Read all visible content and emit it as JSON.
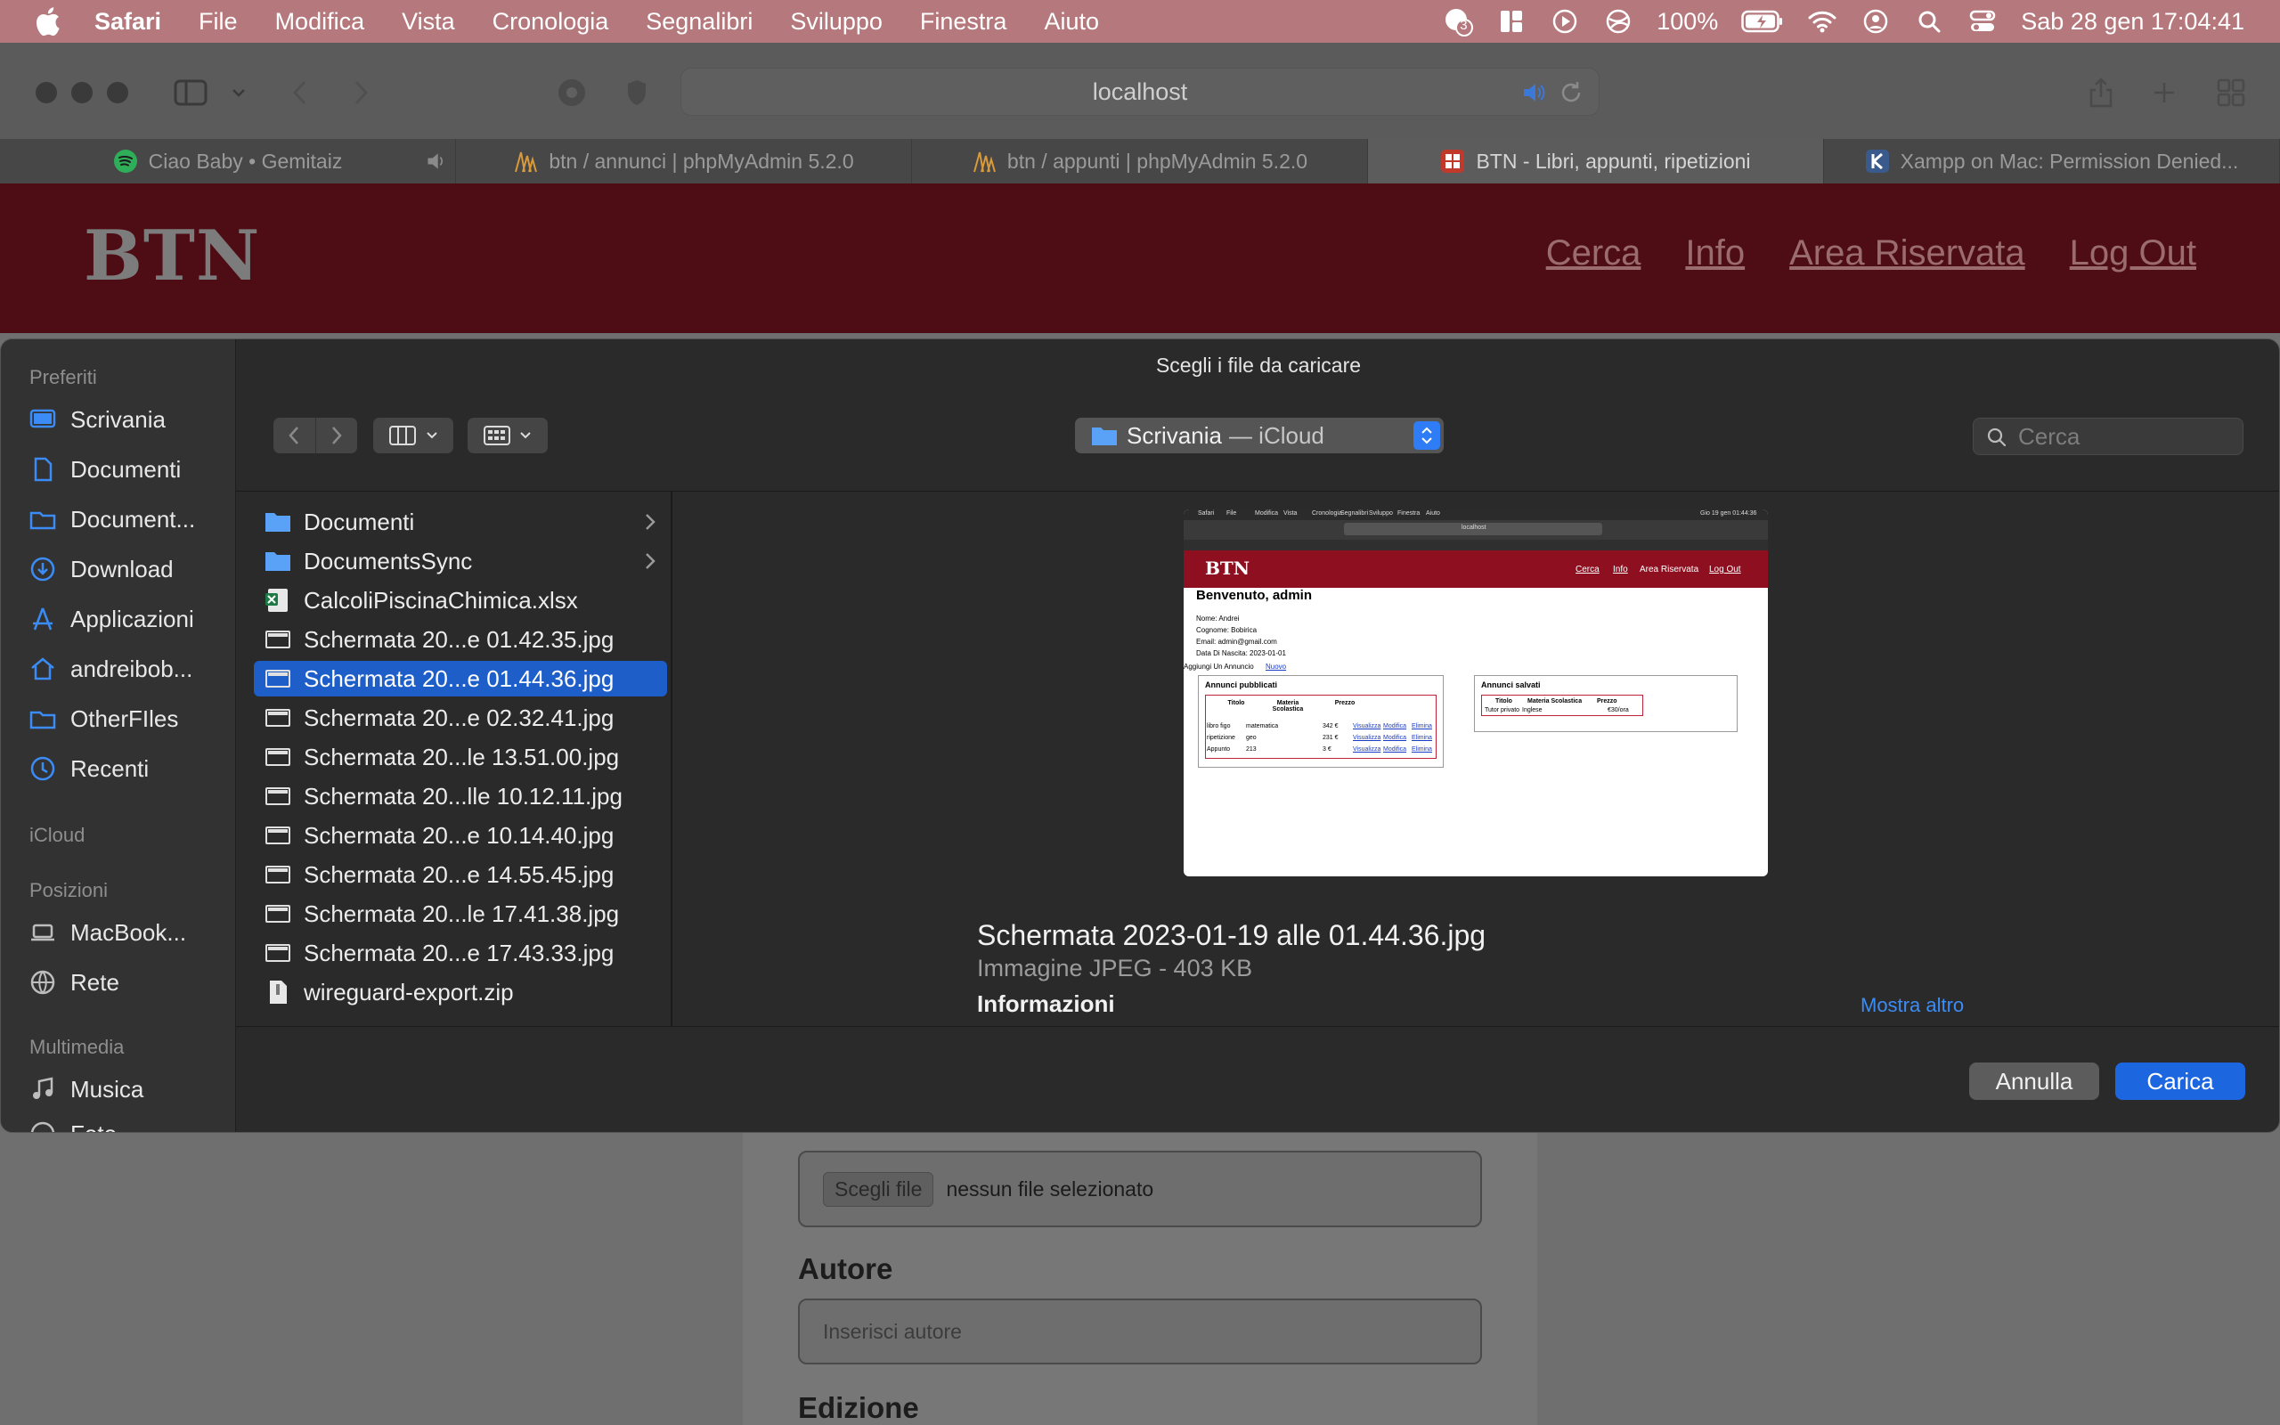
{
  "menubar": {
    "app_name": "Safari",
    "menus": [
      "File",
      "Modifica",
      "Vista",
      "Cronologia",
      "Segnalibri",
      "Sviluppo",
      "Finestra",
      "Aiuto"
    ],
    "badge_count": "3",
    "battery": "100%",
    "datetime": "Sab 28 gen  17:04:41"
  },
  "browser": {
    "address": "localhost",
    "tabs": [
      {
        "title": "Ciao Baby • Gemitaiz",
        "favicon": "spotify-icon"
      },
      {
        "title": "btn / annunci | phpMyAdmin 5.2.0",
        "favicon": "phpmyadmin-icon"
      },
      {
        "title": "btn / appunti | phpMyAdmin 5.2.0",
        "favicon": "phpmyadmin-icon"
      },
      {
        "title": "BTN - Libri, appunti, ripetizioni",
        "favicon": "btn-site-icon"
      },
      {
        "title": "Xampp on Mac: Permission Denied...",
        "favicon": "k-site-icon"
      }
    ]
  },
  "site": {
    "logo": "BTN",
    "nav": [
      "Cerca",
      "Info",
      "Area Riservata",
      "Log Out"
    ],
    "file_button": "Scegli file",
    "file_status": "nessun file selezionato",
    "author_label": "Autore",
    "author_placeholder": "Inserisci autore",
    "edition_label": "Edizione"
  },
  "dialog": {
    "title": "Scegli i file da caricare",
    "location": "Scrivania",
    "location_sub": "— iCloud",
    "search_placeholder": "Cerca",
    "sidebar": {
      "favorites_header": "Preferiti",
      "favorites": [
        {
          "label": "Scrivania",
          "icon": "desktop-icon",
          "active": true
        },
        {
          "label": "Documenti",
          "icon": "document-icon"
        },
        {
          "label": "Document...",
          "icon": "folder-icon"
        },
        {
          "label": "Download",
          "icon": "download-icon"
        },
        {
          "label": "Applicazioni",
          "icon": "applications-icon"
        },
        {
          "label": "andreibob...",
          "icon": "home-icon"
        },
        {
          "label": "OtherFIles",
          "icon": "folder-icon"
        },
        {
          "label": "Recenti",
          "icon": "clock-icon"
        }
      ],
      "icloud_header": "iCloud",
      "locations_header": "Posizioni",
      "locations": [
        {
          "label": "MacBook...",
          "icon": "laptop-icon"
        },
        {
          "label": "Rete",
          "icon": "network-icon"
        }
      ],
      "media_header": "Multimedia",
      "media": [
        {
          "label": "Musica",
          "icon": "music-icon"
        },
        {
          "label": "Foto",
          "icon": "photos-icon"
        }
      ]
    },
    "files": [
      {
        "name": "Documenti",
        "icon": "folder-icon",
        "folder": true
      },
      {
        "name": "DocumentsSync",
        "icon": "folder-icon",
        "folder": true
      },
      {
        "name": "CalcoliPiscinaChimica.xlsx",
        "icon": "excel-icon"
      },
      {
        "name": "Schermata 20...e 01.42.35.jpg",
        "icon": "image-icon"
      },
      {
        "name": "Schermata 20...e 01.44.36.jpg",
        "icon": "image-icon",
        "selected": true
      },
      {
        "name": "Schermata 20...e 02.32.41.jpg",
        "icon": "image-icon"
      },
      {
        "name": "Schermata 20...le 13.51.00.jpg",
        "icon": "image-icon"
      },
      {
        "name": "Schermata 20...lle 10.12.11.jpg",
        "icon": "image-icon"
      },
      {
        "name": "Schermata 20...e 10.14.40.jpg",
        "icon": "image-icon"
      },
      {
        "name": "Schermata 20...e 14.55.45.jpg",
        "icon": "image-icon"
      },
      {
        "name": "Schermata 20...le 17.41.38.jpg",
        "icon": "image-icon"
      },
      {
        "name": "Schermata 20...e 17.43.33.jpg",
        "icon": "image-icon"
      },
      {
        "name": "wireguard-export.zip",
        "icon": "zip-icon"
      }
    ],
    "preview": {
      "filename": "Schermata 2023-01-19 alle 01.44.36.jpg",
      "kind": "Immagine JPEG - 403 KB",
      "info_header": "Informazioni",
      "show_more": "Mostra altro",
      "thumb": {
        "menus": [
          "Safari",
          "File",
          "Modifica",
          "Vista",
          "Cronologia",
          "Segnalibri",
          "Sviluppo",
          "Finestra",
          "Aiuto"
        ],
        "datetime": "Gio 19 gen 01:44:36",
        "address": "localhost",
        "logo": "BTN",
        "nav": [
          "Cerca",
          "Info",
          "Area Riservata",
          "Log Out"
        ],
        "welcome": "Benvenuto, admin",
        "details": [
          "Nome: Andrei",
          "Cognome: Bobirica",
          "Email: admin@gmail.com",
          "Data Di Nascita: 2023-01-01"
        ],
        "add_prefix": "Aggiungi Un Annuncio",
        "add_link": "Nuovo",
        "published_title": "Annunci pubblicati",
        "saved_title": "Annunci salvati",
        "pub_headers": [
          "Titolo",
          "Materia Scolastica",
          "Prezzo"
        ],
        "pub_rows": [
          [
            "libro figo",
            "matematica",
            "342 €"
          ],
          [
            "ripetizione",
            "geo",
            "231 €"
          ],
          [
            "Appunto",
            "213",
            "3 €"
          ]
        ],
        "row_actions": [
          "Visualizza",
          "Modifica",
          "Elimina"
        ],
        "saved_headers": [
          "Titolo",
          "Materia Scolastica",
          "Prezzo"
        ],
        "saved_rows": [
          [
            "Tutor privato",
            "Inglese",
            "€30/ora"
          ]
        ]
      }
    },
    "cancel_label": "Annulla",
    "upload_label": "Carica"
  }
}
